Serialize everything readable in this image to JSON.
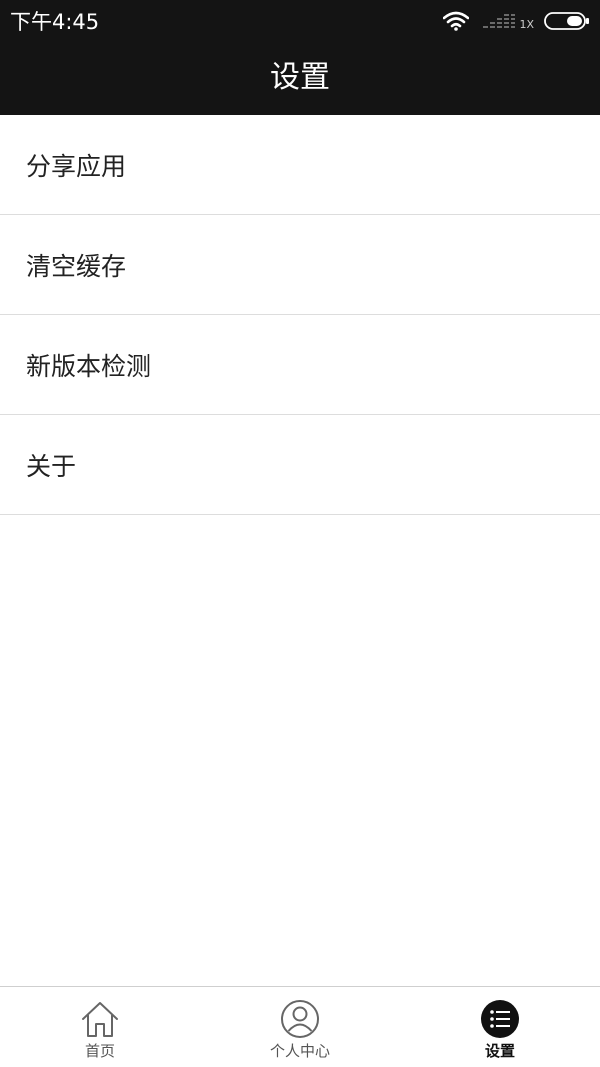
{
  "status_bar": {
    "time": "下午4:45",
    "network_type": "1X",
    "icons": [
      "wifi-icon",
      "signal-icon",
      "battery-icon"
    ]
  },
  "header": {
    "title": "设置"
  },
  "menu": {
    "items": [
      {
        "label": "分享应用"
      },
      {
        "label": "清空缓存"
      },
      {
        "label": "新版本检测"
      },
      {
        "label": "关于"
      }
    ]
  },
  "tab_bar": {
    "tabs": [
      {
        "label": "首页",
        "icon": "home-icon",
        "active": false
      },
      {
        "label": "个人中心",
        "icon": "user-icon",
        "active": false
      },
      {
        "label": "设置",
        "icon": "list-icon",
        "active": true
      }
    ]
  },
  "colors": {
    "header_bg": "#141414",
    "divider": "#dddddd",
    "text_primary": "#222222",
    "tab_inactive": "#555555",
    "tab_active": "#111111"
  }
}
